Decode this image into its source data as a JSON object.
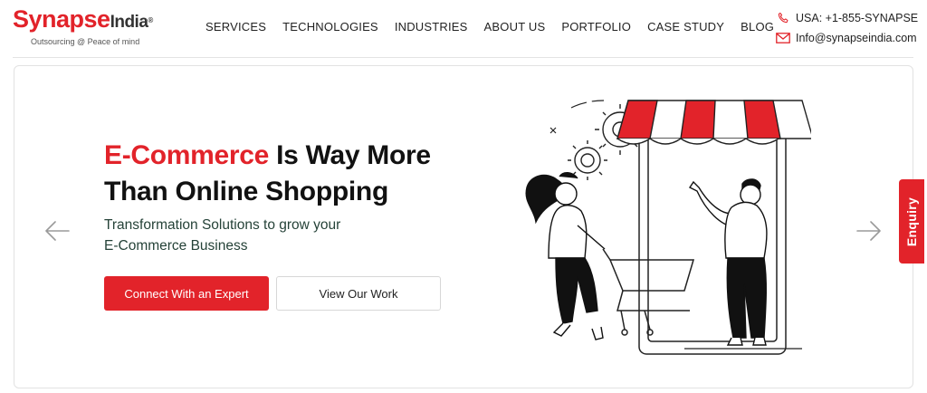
{
  "header": {
    "logo": {
      "synapse": "Synapse",
      "india": "India",
      "reg": "®",
      "tagline": "Outsourcing @ Peace of mind"
    },
    "nav": [
      {
        "label": "SERVICES"
      },
      {
        "label": "TECHNOLOGIES"
      },
      {
        "label": "INDUSTRIES"
      },
      {
        "label": "ABOUT US"
      },
      {
        "label": "PORTFOLIO"
      },
      {
        "label": "CASE STUDY"
      },
      {
        "label": "BLOG"
      }
    ],
    "contact": {
      "phone": "USA: +1-855-SYNAPSE",
      "email": "Info@synapseindia.com"
    }
  },
  "hero": {
    "title_accent": "E-Commerce",
    "title_rest_line1": " Is Way More",
    "title_line2": "Than Online Shopping",
    "subtitle_line1": "Transformation Solutions to grow your",
    "subtitle_line2": "E-Commerce Business",
    "primary_button": "Connect With an Expert",
    "secondary_button": "View Our Work"
  },
  "enquiry_tab": "Enquiry",
  "colors": {
    "brand_red": "#e2232a",
    "subtitle_green": "#254238"
  },
  "icons": [
    "phone-icon",
    "mail-icon",
    "chevron-left-icon",
    "chevron-right-icon"
  ]
}
